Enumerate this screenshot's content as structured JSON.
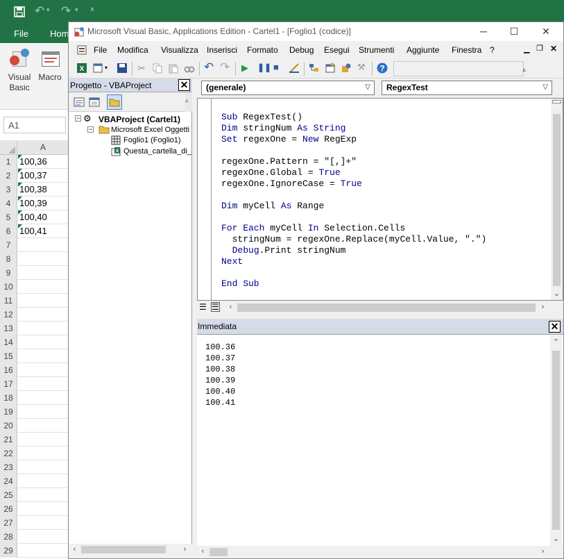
{
  "excel": {
    "ribbon_tabs": [
      "File",
      "Hom"
    ],
    "ribbon_buttons": [
      {
        "label_line1": "Visual",
        "label_line2": "Basic"
      },
      {
        "label_line1": "Macro",
        "label_line2": ""
      }
    ],
    "name_box": "A1",
    "column_header": "A",
    "rows": [
      {
        "n": "1",
        "a": "100,36"
      },
      {
        "n": "2",
        "a": "100,37"
      },
      {
        "n": "3",
        "a": "100,38"
      },
      {
        "n": "4",
        "a": "100,39"
      },
      {
        "n": "5",
        "a": "100,40"
      },
      {
        "n": "6",
        "a": "100,41"
      },
      {
        "n": "7",
        "a": ""
      },
      {
        "n": "8",
        "a": ""
      },
      {
        "n": "9",
        "a": ""
      },
      {
        "n": "10",
        "a": ""
      },
      {
        "n": "11",
        "a": ""
      },
      {
        "n": "12",
        "a": ""
      },
      {
        "n": "13",
        "a": ""
      },
      {
        "n": "14",
        "a": ""
      },
      {
        "n": "15",
        "a": ""
      },
      {
        "n": "16",
        "a": ""
      },
      {
        "n": "17",
        "a": ""
      },
      {
        "n": "18",
        "a": ""
      },
      {
        "n": "19",
        "a": ""
      },
      {
        "n": "20",
        "a": ""
      },
      {
        "n": "21",
        "a": ""
      },
      {
        "n": "22",
        "a": ""
      },
      {
        "n": "23",
        "a": ""
      },
      {
        "n": "24",
        "a": ""
      },
      {
        "n": "25",
        "a": ""
      },
      {
        "n": "26",
        "a": ""
      },
      {
        "n": "27",
        "a": ""
      },
      {
        "n": "28",
        "a": ""
      },
      {
        "n": "29",
        "a": ""
      }
    ],
    "accent_color": "#217346"
  },
  "vbe": {
    "title": "Microsoft Visual Basic, Applications Edition - Cartel1 - [Foglio1 (codice)]",
    "menu": [
      "File",
      "Modifica",
      "Visualizza",
      "Inserisci",
      "Formato",
      "Debug",
      "Esegui",
      "Strumenti",
      "Aggiunte",
      "Finestra",
      "?"
    ],
    "project": {
      "title": "Progetto - VBAProject",
      "root": "VBAProject (Cartel1)",
      "folder": "Microsoft Excel Oggetti",
      "sheet": "Foglio1 (Foglio1)",
      "workbook": "Questa_cartella_di_"
    },
    "code": {
      "object_combo": "(generale)",
      "proc_combo": "RegexTest",
      "lines": [
        [
          {
            "k": 1,
            "t": "Sub "
          },
          {
            "k": 0,
            "t": "RegexTest()"
          }
        ],
        [
          {
            "k": 1,
            "t": "Dim "
          },
          {
            "k": 0,
            "t": "stringNum "
          },
          {
            "k": 1,
            "t": "As String"
          }
        ],
        [
          {
            "k": 1,
            "t": "Set "
          },
          {
            "k": 0,
            "t": "regexOne = "
          },
          {
            "k": 1,
            "t": "New "
          },
          {
            "k": 0,
            "t": "RegExp"
          }
        ],
        [],
        [
          {
            "k": 0,
            "t": "regexOne.Pattern = \"[,]+\""
          }
        ],
        [
          {
            "k": 0,
            "t": "regexOne.Global = "
          },
          {
            "k": 1,
            "t": "True"
          }
        ],
        [
          {
            "k": 0,
            "t": "regexOne.IgnoreCase = "
          },
          {
            "k": 1,
            "t": "True"
          }
        ],
        [],
        [
          {
            "k": 1,
            "t": "Dim "
          },
          {
            "k": 0,
            "t": "myCell "
          },
          {
            "k": 1,
            "t": "As "
          },
          {
            "k": 0,
            "t": "Range"
          }
        ],
        [],
        [
          {
            "k": 1,
            "t": "For Each "
          },
          {
            "k": 0,
            "t": "myCell "
          },
          {
            "k": 1,
            "t": "In "
          },
          {
            "k": 0,
            "t": "Selection.Cells"
          }
        ],
        [
          {
            "k": 0,
            "t": "  stringNum = regexOne.Replace(myCell.Value, \".\")"
          }
        ],
        [
          {
            "k": 0,
            "t": "  "
          },
          {
            "k": 1,
            "t": "Debug"
          },
          {
            "k": 0,
            "t": ".Print stringNum"
          }
        ],
        [
          {
            "k": 1,
            "t": "Next"
          }
        ],
        [],
        [
          {
            "k": 1,
            "t": "End Sub"
          }
        ]
      ]
    },
    "immediate": {
      "title": "Immediata",
      "output": [
        "100.36",
        "100.37",
        "100.38",
        "100.39",
        "100.40",
        "100.41"
      ]
    },
    "keyword_color": "#00008b"
  }
}
